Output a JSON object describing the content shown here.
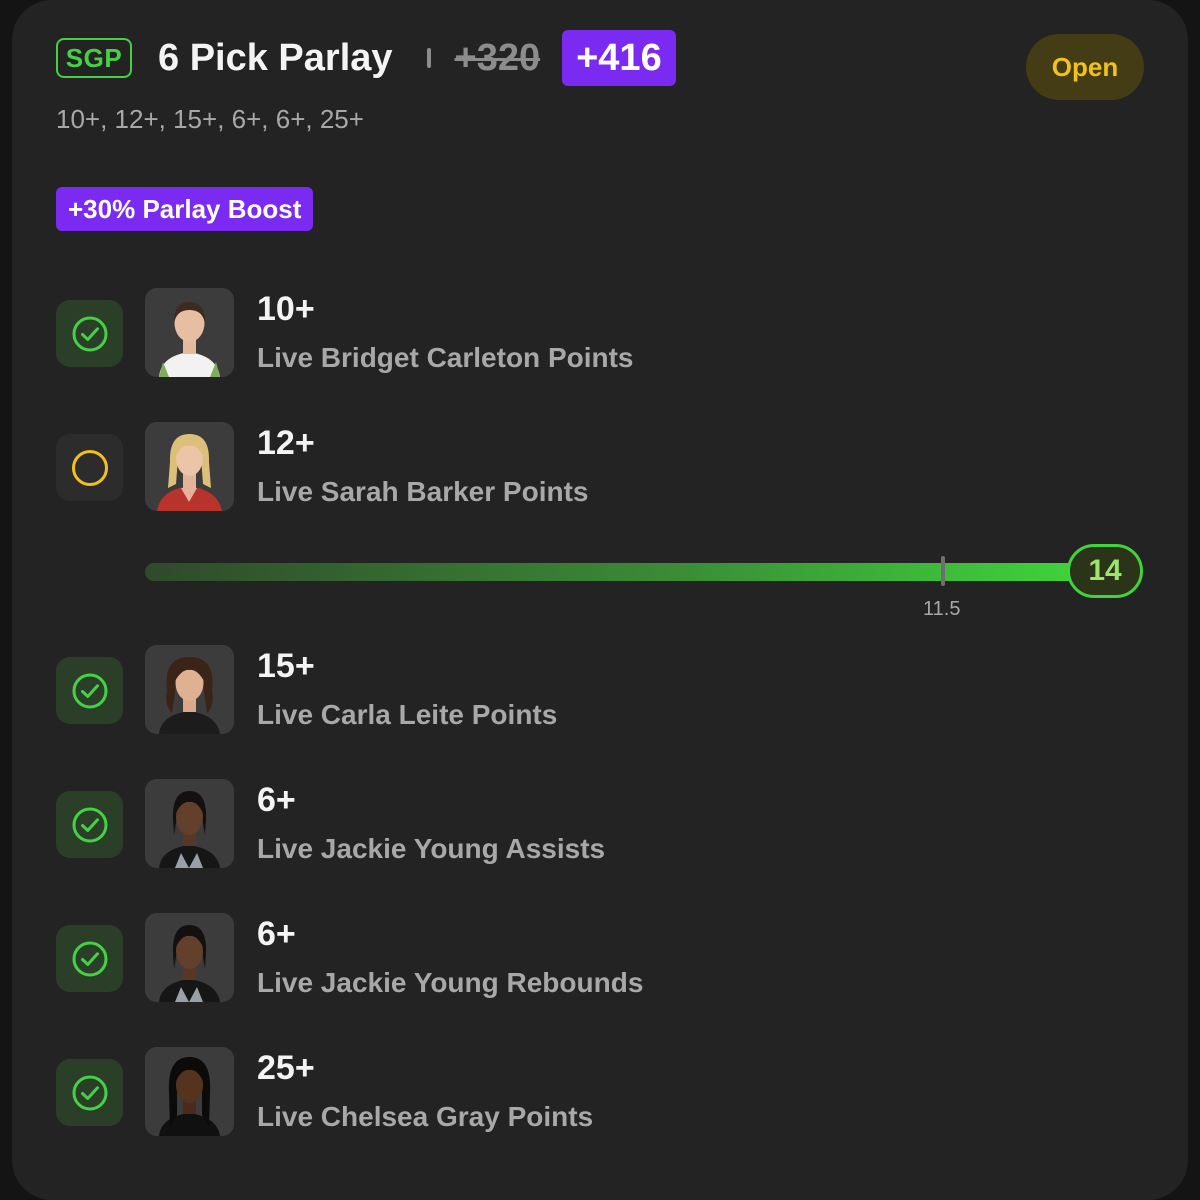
{
  "header": {
    "badge": "SGP",
    "title": "6 Pick Parlay",
    "old_odds": "+320",
    "new_odds": "+416",
    "status": "Open"
  },
  "subtitle": "10+, 12+, 15+, 6+, 6+, 25+",
  "boost": "+30% Parlay Boost",
  "picks": [
    {
      "line": "10+",
      "market": "Live Bridget Carleton Points",
      "status": "won",
      "status_icon": "check-circle-icon"
    },
    {
      "line": "12+",
      "market": "Live Sarah Barker Points",
      "status": "pending",
      "status_icon": "circle-icon"
    },
    {
      "line": "15+",
      "market": "Live Carla Leite Points",
      "status": "won",
      "status_icon": "check-circle-icon"
    },
    {
      "line": "6+",
      "market": "Live Jackie Young Assists",
      "status": "won",
      "status_icon": "check-circle-icon"
    },
    {
      "line": "6+",
      "market": "Live Jackie Young Rebounds",
      "status": "won",
      "status_icon": "check-circle-icon"
    },
    {
      "line": "25+",
      "market": "Live Chelsea Gray Points",
      "status": "won",
      "status_icon": "check-circle-icon"
    }
  ],
  "progress": {
    "current_value": "14",
    "line_marker": "11.5"
  },
  "colors": {
    "accent_purple": "#7a2af1",
    "win_green": "#45d145",
    "pending_yellow": "#f1c21b",
    "background": "#232323"
  }
}
